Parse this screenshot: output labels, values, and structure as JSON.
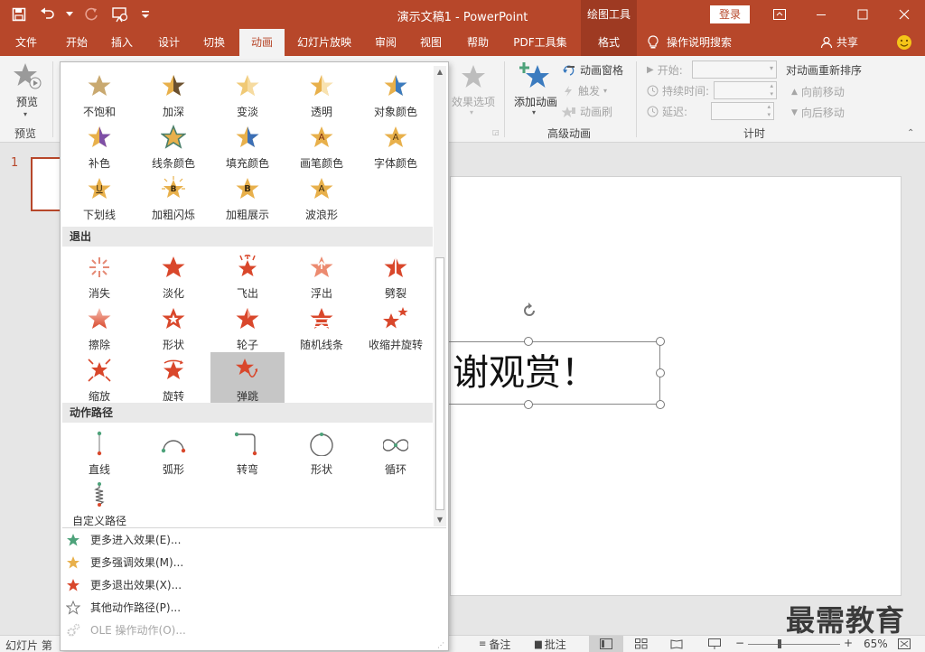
{
  "titlebar": {
    "title": "演示文稿1 - PowerPoint",
    "context_tools": "绘图工具",
    "login": "登录"
  },
  "tabs": [
    {
      "label": "文件",
      "x": 0,
      "w": 58
    },
    {
      "label": "开始"
    },
    {
      "label": "插入"
    },
    {
      "label": "设计"
    },
    {
      "label": "切换"
    },
    {
      "label": "动画"
    },
    {
      "label": "幻灯片放映"
    },
    {
      "label": "审阅"
    },
    {
      "label": "视图"
    },
    {
      "label": "帮助"
    },
    {
      "label": "PDF工具集"
    },
    {
      "label": "格式"
    }
  ],
  "tellme": "操作说明搜索",
  "share": "共享",
  "ribbon": {
    "preview_label": "预览",
    "preview_group": "预览",
    "effect_options": "效果选项",
    "add_animation": "添加动画",
    "anim_pane": "动画窗格",
    "trigger": "触发",
    "anim_painter": "动画刷",
    "advanced_group": "高级动画",
    "start_label": "开始:",
    "duration_label": "持续时间:",
    "delay_label": "延迟:",
    "timing_group": "计时",
    "reorder_title": "对动画重新排序",
    "move_earlier": "向前移动",
    "move_later": "向后移动"
  },
  "thumb_number": "1",
  "slide_text": "谢观赏！",
  "gallery": {
    "emphasis_row1": [
      "不饱和",
      "加深",
      "变淡",
      "透明",
      "对象颜色"
    ],
    "emphasis_row2": [
      "补色",
      "线条颜色",
      "填充颜色",
      "画笔颜色",
      "字体颜色"
    ],
    "emphasis_row3": [
      "下划线",
      "加粗闪烁",
      "加粗展示",
      "波浪形"
    ],
    "exit_header": "退出",
    "exit_row1": [
      "消失",
      "淡化",
      "飞出",
      "浮出",
      "劈裂"
    ],
    "exit_row2": [
      "擦除",
      "形状",
      "轮子",
      "随机线条",
      "收缩并旋转"
    ],
    "exit_row3": [
      "缩放",
      "旋转",
      "弹跳"
    ],
    "path_header": "动作路径",
    "path_row1": [
      "直线",
      "弧形",
      "转弯",
      "形状",
      "循环"
    ],
    "path_row2": [
      "自定义路径"
    ],
    "badge_letters": {
      "fontcolor": "A",
      "pencolor": "A",
      "underline": "U",
      "boldflash": "B",
      "boldreveal": "B",
      "wave": "A"
    },
    "menu": [
      "更多进入效果(E)...",
      "更多强调效果(M)...",
      "更多退出效果(X)...",
      "其他动作路径(P)...",
      "OLE 操作动作(O)..."
    ]
  },
  "status": {
    "slide_label": "幻灯片 第",
    "notes": "备注",
    "comments": "批注",
    "zoom": "65%"
  },
  "watermark": "最需教育",
  "colors": {
    "accent": "#b7472a",
    "gold": "#e8b04b",
    "exit_red": "#d9472b",
    "green": "#4da27a"
  }
}
